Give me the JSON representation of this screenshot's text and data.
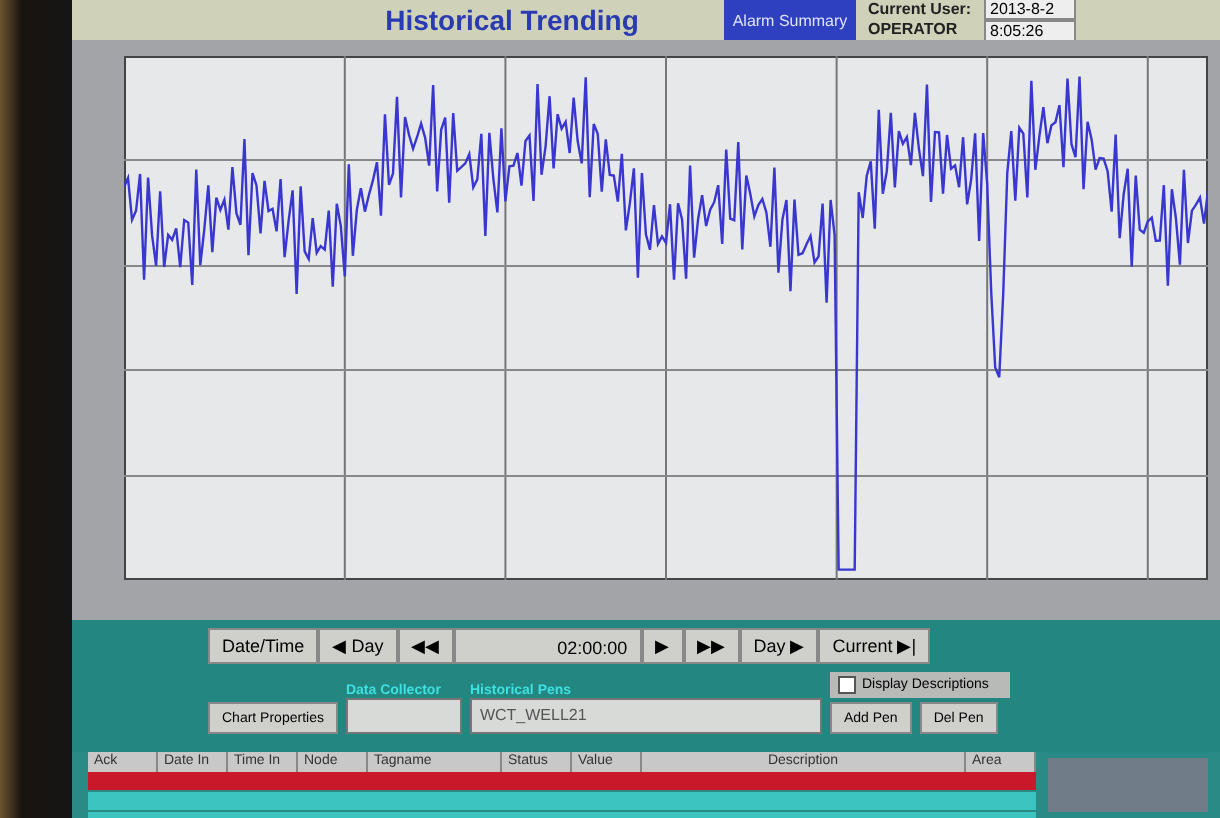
{
  "header": {
    "title": "Historical Trending",
    "alarm_button": "Alarm Summary",
    "user_label": "Current User:",
    "user_value": "OPERATOR",
    "date": "2013-8-2",
    "time": "8:05:26"
  },
  "navigation": {
    "buttons": [
      "Date/Time",
      "◀ Day",
      "◀◀"
    ],
    "time_value": "02:00:00",
    "buttons_after": [
      "▶",
      "▶▶",
      "Day ▶",
      "Current ▶|"
    ]
  },
  "pens": {
    "chart_properties": "Chart Properties",
    "collector_label": "Data Collector",
    "pens_label": "Historical Pens",
    "pen_value": "WCT_WELL21",
    "add": "Add Pen",
    "delete": "Del Pen"
  },
  "display_descriptions": {
    "label": "Display Descriptions",
    "checked": false
  },
  "alarm_table": {
    "columns": [
      "Ack",
      "Date In",
      "Time In",
      "Node",
      "Tagname",
      "Status",
      "Value",
      "Description",
      "Area"
    ],
    "rows": [
      {
        "color": "#c8182a"
      },
      {
        "color": "#3cc4c0"
      }
    ]
  }
}
